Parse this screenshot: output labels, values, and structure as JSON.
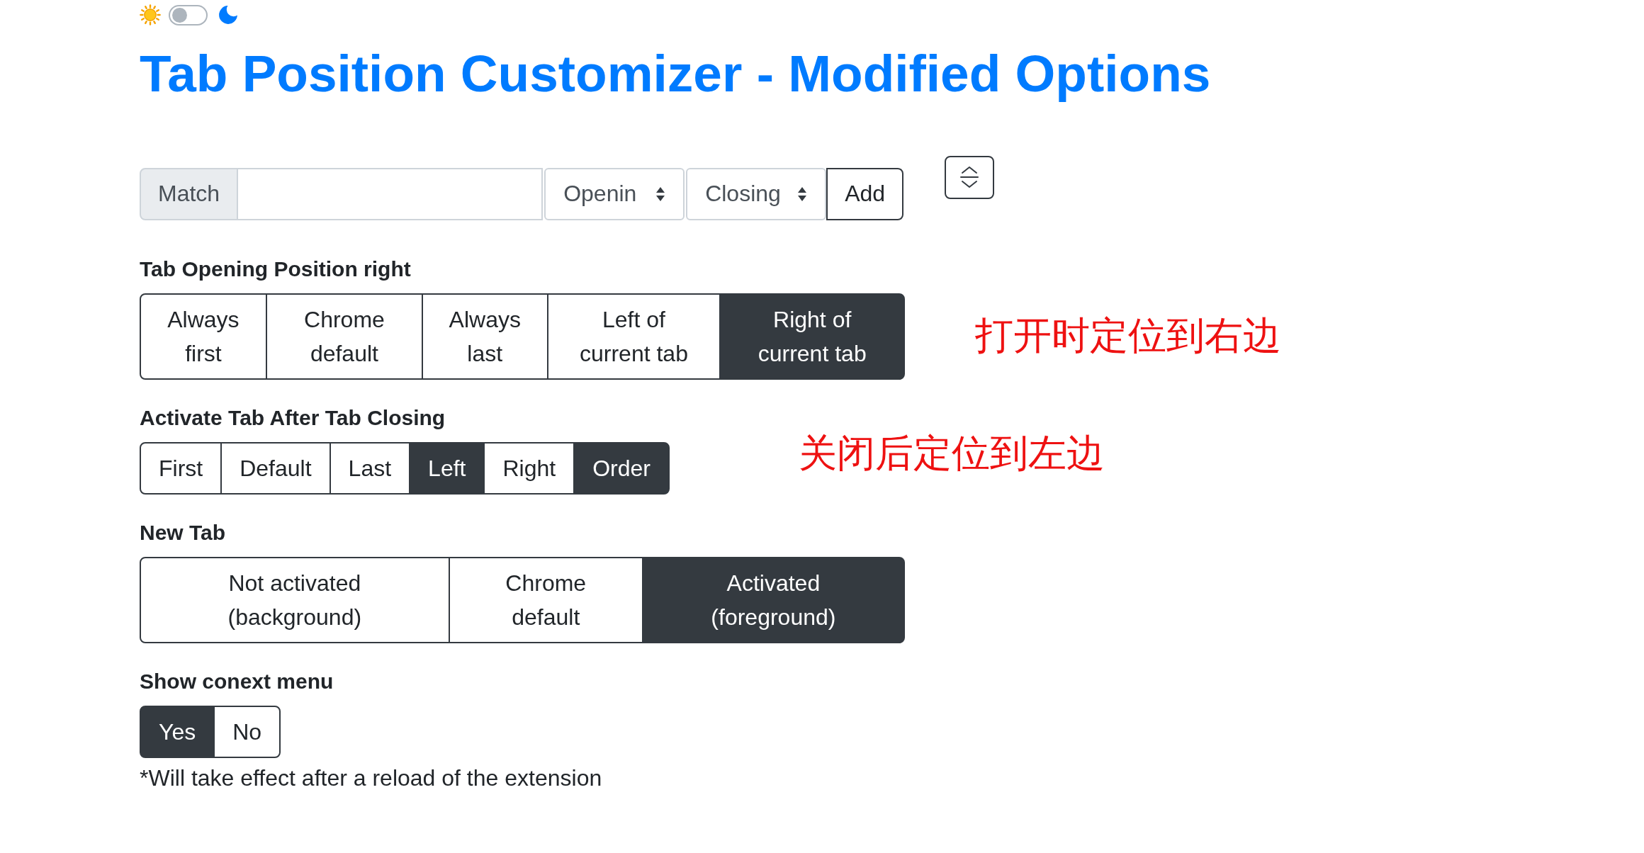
{
  "theme_switch": {
    "on": false
  },
  "title": "Tab Position Customizer - Modified Options",
  "match_row": {
    "label": "Match",
    "selects": [
      {
        "value": "Openin"
      },
      {
        "value": "Closing"
      }
    ],
    "button": "Add"
  },
  "sections": [
    {
      "label": "Tab Opening Position right",
      "options": [
        {
          "label": "Always first",
          "selected": false
        },
        {
          "label": "Chrome default",
          "selected": false
        },
        {
          "label": "Always last",
          "selected": false
        },
        {
          "label": "Left of current tab",
          "selected": false
        },
        {
          "label": "Right of current tab",
          "selected": true
        }
      ],
      "annotation": "打开时定位到右边"
    },
    {
      "label": "Activate Tab After Tab Closing",
      "options": [
        {
          "label": "First",
          "selected": false
        },
        {
          "label": "Default",
          "selected": false
        },
        {
          "label": "Last",
          "selected": false
        },
        {
          "label": "Left",
          "selected": true
        },
        {
          "label": "Right",
          "selected": false
        },
        {
          "label": "Order",
          "selected": true
        }
      ],
      "annotation": "关闭后定位到左边"
    },
    {
      "label": "New Tab",
      "options": [
        {
          "label": "Not activated (background)",
          "selected": false
        },
        {
          "label": "Chrome default",
          "selected": false
        },
        {
          "label": "Activated (foreground)",
          "selected": true
        }
      ]
    },
    {
      "label": "Show conext menu",
      "options": [
        {
          "label": "Yes",
          "selected": true
        },
        {
          "label": "No",
          "selected": false
        }
      ],
      "note": "*Will take effect after a reload of the extension"
    }
  ]
}
